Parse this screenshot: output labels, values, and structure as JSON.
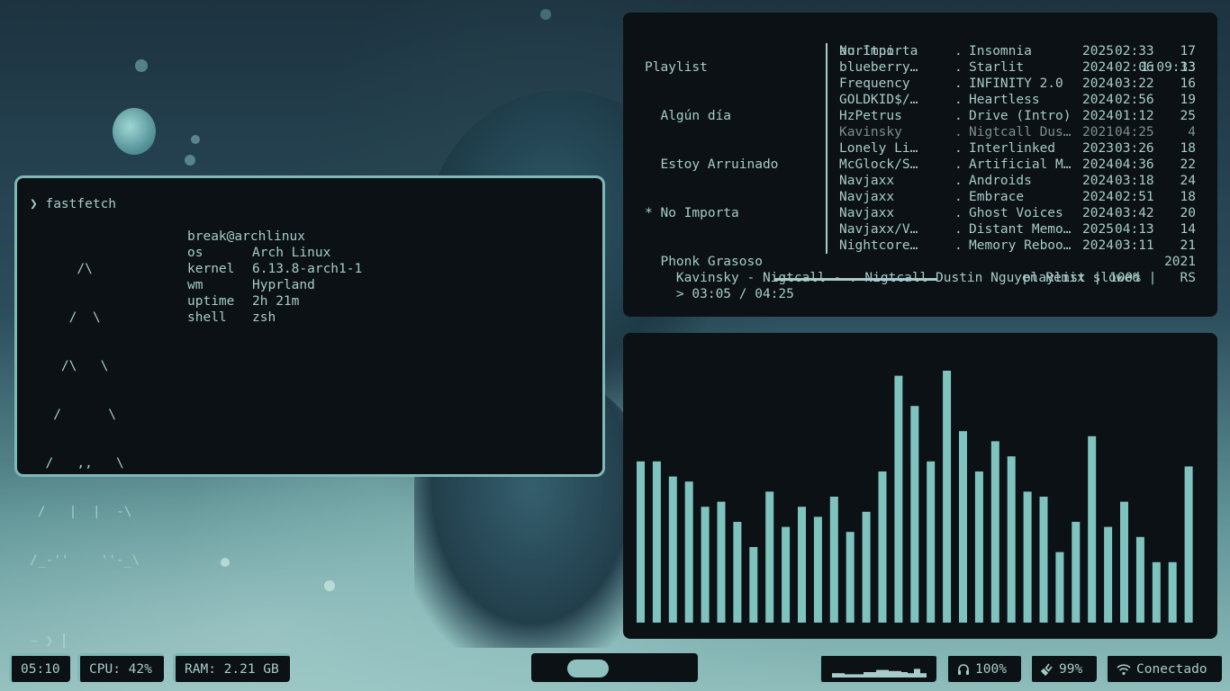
{
  "terminal": {
    "command_line": "❯ fastfetch",
    "ascii_logo": [
      "      /\\",
      "     /  \\",
      "    /\\   \\",
      "   /      \\",
      "  /   ,,   \\",
      " /   |  |  -\\",
      "/_-''    ''-_\\"
    ],
    "user_host": "break@archlinux",
    "info": [
      {
        "key": "os",
        "value": "Arch Linux"
      },
      {
        "key": "kernel",
        "value": "6.13.8-arch1-1"
      },
      {
        "key": "wm",
        "value": "Hyprland"
      },
      {
        "key": "uptime",
        "value": "2h 21m"
      },
      {
        "key": "shell",
        "value": "zsh"
      }
    ],
    "prompt": "~ ❯ "
  },
  "player": {
    "playlists_title": "Playlist",
    "playlists": [
      {
        "label": "  Algún día"
      },
      {
        "label": "  Estoy Arruinado"
      },
      {
        "label": "* No Importa"
      },
      {
        "label": "  Phonk Grasoso"
      }
    ],
    "current_playlist": "No Importa",
    "playlist_duration": "1:09:33",
    "tracks": [
      {
        "artist": "auritni",
        "sep": ".",
        "title": "Insomnia",
        "year": "2025",
        "duration": "02:33",
        "num": "17"
      },
      {
        "artist": "blueberry…",
        "sep": ".",
        "title": "Starlit",
        "year": "2024",
        "duration": "02:06",
        "num": "13"
      },
      {
        "artist": "Frequency",
        "sep": ".",
        "title": "INFINITY 2.0",
        "year": "2024",
        "duration": "03:22",
        "num": "16"
      },
      {
        "artist": "GOLDKID$/…",
        "sep": ".",
        "title": "Heartless",
        "year": "2024",
        "duration": "02:56",
        "num": "19"
      },
      {
        "artist": "HzPetrus",
        "sep": ".",
        "title": "Drive (Intro)",
        "year": "2024",
        "duration": "01:12",
        "num": "25"
      },
      {
        "artist": "Kavinsky",
        "sep": ".",
        "title": "Nigtcall Dus…",
        "year": "2021",
        "duration": "04:25",
        "num": "4"
      },
      {
        "artist": "Lonely Li…",
        "sep": ".",
        "title": "Interlinked",
        "year": "2023",
        "duration": "03:26",
        "num": "18"
      },
      {
        "artist": "McGlock/S…",
        "sep": ".",
        "title": "Artificial M…",
        "year": "2024",
        "duration": "04:36",
        "num": "22"
      },
      {
        "artist": "Navjaxx",
        "sep": ".",
        "title": "Androids",
        "year": "2024",
        "duration": "03:18",
        "num": "24"
      },
      {
        "artist": "Navjaxx",
        "sep": ".",
        "title": "Embrace",
        "year": "2024",
        "duration": "02:51",
        "num": "18"
      },
      {
        "artist": "Navjaxx",
        "sep": ".",
        "title": "Ghost Voices",
        "year": "2024",
        "duration": "03:42",
        "num": "20"
      },
      {
        "artist": "Navjaxx/V…",
        "sep": ".",
        "title": "Distant Memo…",
        "year": "2025",
        "duration": "04:13",
        "num": "14"
      },
      {
        "artist": "Nightcore…",
        "sep": ".",
        "title": "Memory Reboo…",
        "year": "2024",
        "duration": "03:11",
        "num": "21"
      }
    ],
    "now_playing": "Kavinsky - Nigtcall - . Nigtcall Dustin Nguyen Remix slowed",
    "now_playing_year": "2021",
    "progress_text": "> 03:05 / 04:25",
    "progress_fraction": 0.698,
    "status_text": "playlist | 100% |   RS"
  },
  "visualizer": {
    "levels": [
      0.32,
      0.32,
      0.29,
      0.28,
      0.23,
      0.24,
      0.2,
      0.15,
      0.26,
      0.19,
      0.23,
      0.21,
      0.25,
      0.18,
      0.22,
      0.3,
      0.49,
      0.43,
      0.32,
      0.5,
      0.38,
      0.3,
      0.36,
      0.33,
      0.26,
      0.25,
      0.14,
      0.2,
      0.37,
      0.19,
      0.24,
      0.17,
      0.12,
      0.12,
      0.31
    ],
    "color": "#7fc3bf"
  },
  "bar": {
    "clock": "05:10",
    "cpu": "CPU: 42%",
    "ram": "RAM: 2.21 GB",
    "mini_levels": [
      0.4,
      0.4,
      0.3,
      0.3,
      0.3,
      0.5,
      0.5,
      0.7,
      0.7,
      0.6,
      0.6,
      0.5,
      0.4,
      0.8,
      0.4
    ],
    "volume": "100%",
    "volume_icon": "headphones-icon",
    "battery": "99%",
    "battery_icon": "plug-icon",
    "network": "Conectado",
    "network_icon": "wifi-icon"
  },
  "colors": {
    "accent": "#7fb8b5",
    "text": "#a7ccc9",
    "panel_bg": "#0b1114"
  }
}
